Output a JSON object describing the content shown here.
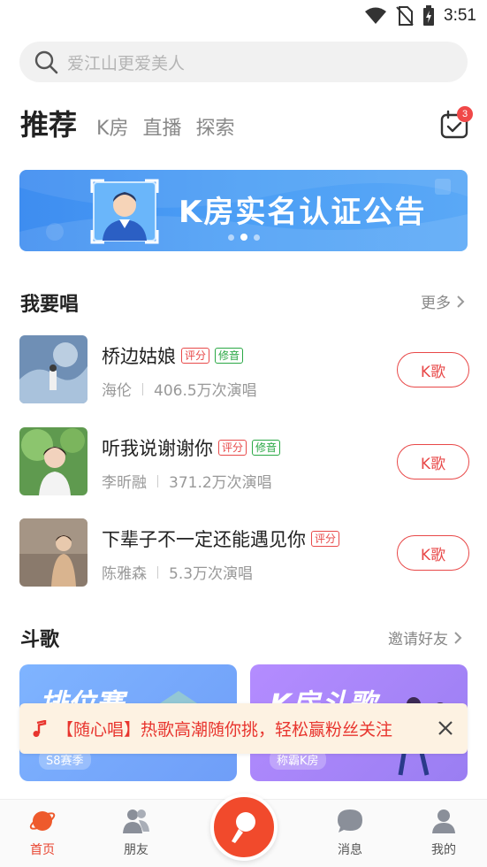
{
  "status_bar": {
    "time": "3:51"
  },
  "search": {
    "placeholder": "爱江山更爱美人"
  },
  "tabs": [
    {
      "label": "推荐",
      "active": true
    },
    {
      "label": "K房",
      "active": false
    },
    {
      "label": "直播",
      "active": false
    },
    {
      "label": "探索",
      "active": false
    }
  ],
  "calendar": {
    "badge": "3"
  },
  "banner": {
    "title": "K房实名认证公告",
    "page_count": 3,
    "active_index": 1
  },
  "sing_section": {
    "title": "我要唱",
    "more": "更多"
  },
  "songs": [
    {
      "name": "桥边姑娘",
      "tags": [
        "评分",
        "修音"
      ],
      "artist": "海伦",
      "plays": "406.5万次演唱",
      "button": "K歌"
    },
    {
      "name": "听我说谢谢你",
      "tags": [
        "评分",
        "修音"
      ],
      "artist": "李昕融",
      "plays": "371.2万次演唱",
      "button": "K歌"
    },
    {
      "name": "下辈子不一定还能遇见你",
      "tags": [
        "评分"
      ],
      "artist": "陈雅森",
      "plays": "5.3万次演唱",
      "button": "K歌"
    }
  ],
  "battle_section": {
    "title": "斗歌",
    "more": "邀请好友"
  },
  "cards": [
    {
      "title": "排位赛",
      "sub": "S8赛季"
    },
    {
      "title": "K房斗歌",
      "sub": "称霸K房"
    }
  ],
  "toast": {
    "text": "【随心唱】热歌高潮随你挑，轻松赢粉丝关注"
  },
  "bottom_nav": [
    {
      "label": "首页",
      "active": true
    },
    {
      "label": "朋友",
      "active": false
    },
    {
      "label": "消息",
      "active": false
    },
    {
      "label": "我的",
      "active": false
    }
  ],
  "colors": {
    "accent": "#e8432e",
    "banner": "#4c9ff5",
    "toast_bg": "#fdf2e2"
  }
}
